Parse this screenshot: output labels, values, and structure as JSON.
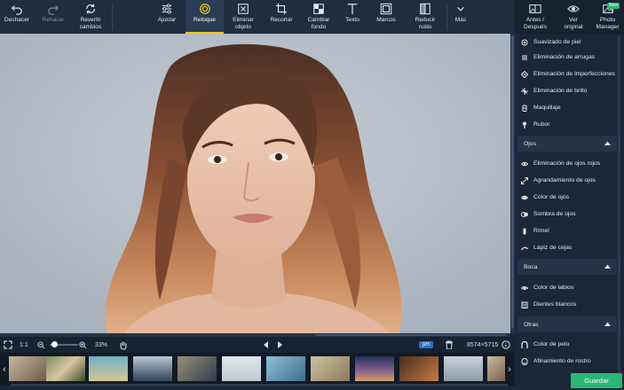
{
  "toolbar": {
    "undo": "Deshacer",
    "redo": "Rehacer",
    "revert_l1": "Revertir",
    "revert_l2": "cambios",
    "adjust": "Ajustar",
    "retouch": "Retoque",
    "remove_l1": "Eliminar",
    "remove_l2": "objeto",
    "crop": "Recortar",
    "bg_l1": "Cambiar",
    "bg_l2": "fondo",
    "text": "Texto",
    "frames": "Marcos",
    "noise_l1": "Reducir",
    "noise_l2": "ruido",
    "more": "Más",
    "before_l1": "Antes /",
    "before_l2": "Después",
    "original_l1": "Ver",
    "original_l2": "original",
    "manager_l1": "Photo",
    "manager_l2": "Manager",
    "new_badge": "New"
  },
  "status": {
    "fit": "1:1",
    "zoom": "33%",
    "zoom_level": 0.15,
    "badge": "pH",
    "dimensions": "8574×5715"
  },
  "panel": {
    "piel_items": [
      {
        "label": "Suavizado de piel",
        "icon": "smooth-skin-icon"
      },
      {
        "label": "Eliminación de arrugas",
        "icon": "wrinkle-icon"
      },
      {
        "label": "Eliminación de imperfecciones",
        "icon": "blemish-icon"
      },
      {
        "label": "Eliminación de brillo",
        "icon": "shine-icon"
      },
      {
        "label": "Maquillaje",
        "icon": "makeup-icon"
      },
      {
        "label": "Rubor",
        "icon": "blush-icon"
      }
    ],
    "ojos_title": "Ojos",
    "ojos_items": [
      {
        "label": "Eliminación de ojos rojos",
        "icon": "red-eye-icon"
      },
      {
        "label": "Agrandamiento de ojos",
        "icon": "eye-enlarge-icon"
      },
      {
        "label": "Color de ojos",
        "icon": "eye-color-icon"
      },
      {
        "label": "Sombra de ojos",
        "icon": "eyeshadow-icon"
      },
      {
        "label": "Rímel",
        "icon": "mascara-icon"
      },
      {
        "label": "Lápiz de cejas",
        "icon": "eyebrow-icon"
      }
    ],
    "boca_title": "Boca",
    "boca_items": [
      {
        "label": "Color de labios",
        "icon": "lip-color-icon"
      },
      {
        "label": "Dientes blancos",
        "icon": "teeth-icon"
      }
    ],
    "otras_title": "Otras",
    "otras_items": [
      {
        "label": "Color de pelo",
        "icon": "hair-color-icon"
      },
      {
        "label": "Afinamiento de rostro",
        "icon": "face-slim-icon"
      }
    ]
  },
  "save_label": "Guardar",
  "colors": {
    "accent_active": "#f0c419",
    "save_green": "#2bb673",
    "panel_bg": "#1b2738"
  }
}
